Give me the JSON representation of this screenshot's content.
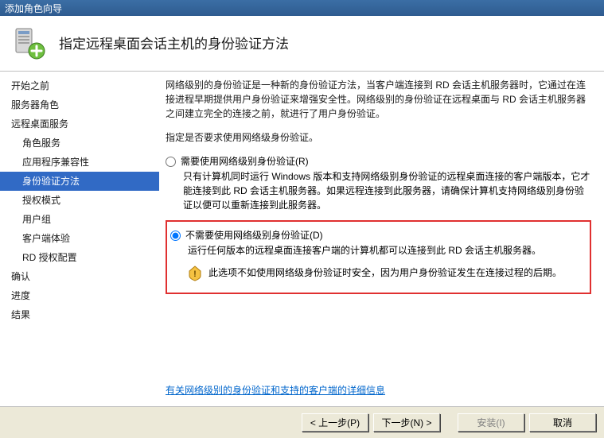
{
  "window": {
    "title": "添加角色向导"
  },
  "header": {
    "title": "指定远程桌面会话主机的身份验证方法"
  },
  "sidebar": {
    "items": [
      {
        "label": "开始之前",
        "sub": false
      },
      {
        "label": "服务器角色",
        "sub": false
      },
      {
        "label": "远程桌面服务",
        "sub": false
      },
      {
        "label": "角色服务",
        "sub": true
      },
      {
        "label": "应用程序兼容性",
        "sub": true
      },
      {
        "label": "身份验证方法",
        "sub": true,
        "selected": true
      },
      {
        "label": "授权模式",
        "sub": true
      },
      {
        "label": "用户组",
        "sub": true
      },
      {
        "label": "客户端体验",
        "sub": true
      },
      {
        "label": "RD 授权配置",
        "sub": true
      },
      {
        "label": "确认",
        "sub": false
      },
      {
        "label": "进度",
        "sub": false
      },
      {
        "label": "结果",
        "sub": false
      }
    ]
  },
  "content": {
    "intro": "网络级别的身份验证是一种新的身份验证方法，当客户端连接到 RD 会话主机服务器时，它通过在连接进程早期提供用户身份验证来增强安全性。网络级别的身份验证在远程桌面与 RD 会话主机服务器之间建立完全的连接之前，就进行了用户身份验证。",
    "prompt": "指定是否要求使用网络级身份验证。",
    "option1": {
      "label": "需要使用网络级别身份验证(R)",
      "desc": "只有计算机同时运行 Windows 版本和支持网络级别身份验证的远程桌面连接的客户端版本，它才能连接到此 RD 会话主机服务器。如果远程连接到此服务器，请确保计算机支持网络级别身份验证以便可以重新连接到此服务器。"
    },
    "option2": {
      "label": "不需要使用网络级别身份验证(D)",
      "desc": "运行任何版本的远程桌面连接客户端的计算机都可以连接到此 RD 会话主机服务器。",
      "warning": "此选项不如使用网络级身份验证时安全，因为用户身份验证发生在连接过程的后期。"
    },
    "link": "有关网络级别的身份验证和支持的客户端的详细信息"
  },
  "footer": {
    "prev": "< 上一步(P)",
    "next": "下一步(N) >",
    "install": "安装(I)",
    "cancel": "取消"
  }
}
